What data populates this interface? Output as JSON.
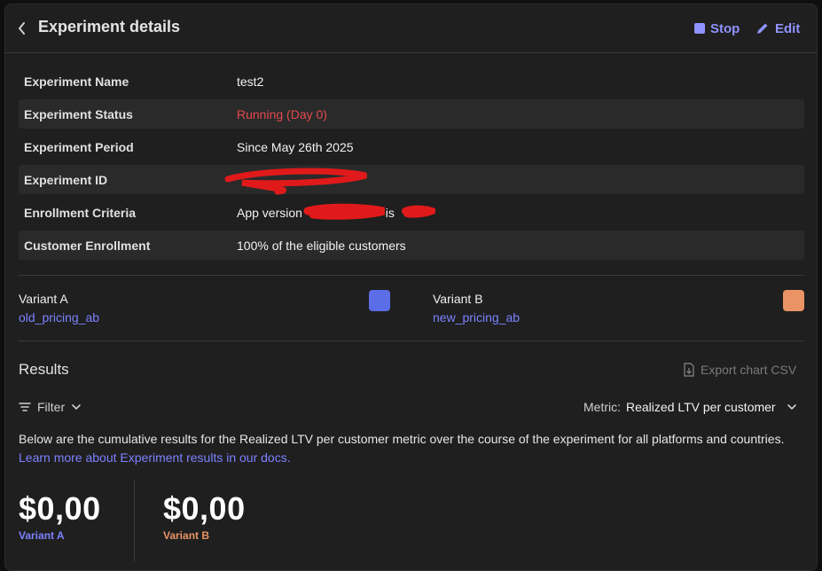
{
  "header": {
    "title": "Experiment details",
    "stop_label": "Stop",
    "edit_label": "Edit"
  },
  "details": [
    {
      "key": "Experiment Name",
      "value": "test2"
    },
    {
      "key": "Experiment Status",
      "value": "Running (Day 0)"
    },
    {
      "key": "Experiment Period",
      "value": "Since May 26th 2025"
    },
    {
      "key": "Experiment ID",
      "value": ""
    },
    {
      "key": "Enrollment Criteria",
      "value": "App version",
      "value_suffix": "is"
    },
    {
      "key": "Customer Enrollment",
      "value": "100% of the eligible customers"
    }
  ],
  "variants": [
    {
      "name": "Variant A",
      "offering": "old_pricing_ab",
      "color": "#5b6ee8"
    },
    {
      "name": "Variant B",
      "offering": "new_pricing_ab",
      "color": "#ea9466"
    }
  ],
  "results": {
    "title": "Results",
    "export_label": "Export chart CSV",
    "filter_label": "Filter",
    "metric_label": "Metric:",
    "metric_value": "Realized LTV per customer",
    "description": "Below are the cumulative results for the Realized LTV per customer metric over the course of the experiment for all platforms and countries.",
    "learn_more": "Learn more about Experiment results in our docs.",
    "stats": [
      {
        "value": "$0,00",
        "label": "Variant A",
        "color": "#7c82ff"
      },
      {
        "value": "$0,00",
        "label": "Variant B",
        "color": "#ea9466"
      }
    ]
  },
  "colors": {
    "accent": "#8f93ff",
    "status_running": "#e5484d",
    "redaction": "#e01a1a"
  }
}
